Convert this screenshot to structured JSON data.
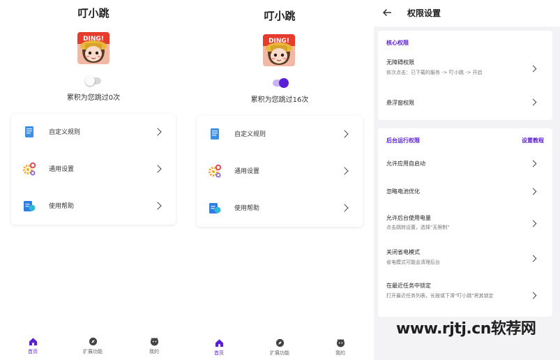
{
  "home": {
    "app_title": "叮小跳",
    "avatar_text": "DING!",
    "counter": "累积为您跳过0次",
    "menu": [
      {
        "label": "自定义规则",
        "icon": "book-icon"
      },
      {
        "label": "通用设置",
        "icon": "gears-icon"
      },
      {
        "label": "使用帮助",
        "icon": "help-doc-icon"
      }
    ],
    "nav": [
      {
        "label": "首页",
        "icon": "home-icon",
        "active": true
      },
      {
        "label": "扩展功能",
        "icon": "compass-icon",
        "active": false
      },
      {
        "label": "我的",
        "icon": "face-icon",
        "active": false
      }
    ]
  },
  "home_on": {
    "app_title": "叮小跳",
    "avatar_text": "DING!",
    "counter": "累积为您跳过16次",
    "menu": [
      {
        "label": "自定义规则",
        "icon": "book-icon"
      },
      {
        "label": "通用设置",
        "icon": "gears-icon"
      },
      {
        "label": "使用帮助",
        "icon": "help-doc-icon"
      }
    ],
    "nav": [
      {
        "label": "首页",
        "icon": "home-icon",
        "active": true
      },
      {
        "label": "扩展功能",
        "icon": "compass-icon",
        "active": false
      },
      {
        "label": "我的",
        "icon": "face-icon",
        "active": false
      }
    ]
  },
  "permissions": {
    "title": "权限设置",
    "core": {
      "title": "核心权限",
      "items": [
        {
          "title": "无障碍权限",
          "desc": "依次点击：已下载的服务 -> 叮小跳 -> 开启"
        },
        {
          "title": "悬浮窗权限",
          "desc": ""
        }
      ]
    },
    "background": {
      "title": "后台运行权限",
      "link": "设置教程",
      "items": [
        {
          "title": "允许应用自启动",
          "desc": ""
        },
        {
          "title": "忽略电池优化",
          "desc": ""
        },
        {
          "title": "允许后台使用电量",
          "desc": "点击跳转设置，选择\"无限制\""
        },
        {
          "title": "关闭省电模式",
          "desc": "省电模式可能会清理后台"
        },
        {
          "title": "在最近任务中锁定",
          "desc": "打开最近任务列表，长按或下滑\"叮小跳\"将其锁定"
        }
      ]
    }
  },
  "watermark": "www.rjtj.cn软荐网",
  "colors": {
    "accent": "#5b1fd6",
    "background": "#f3f3f5"
  }
}
